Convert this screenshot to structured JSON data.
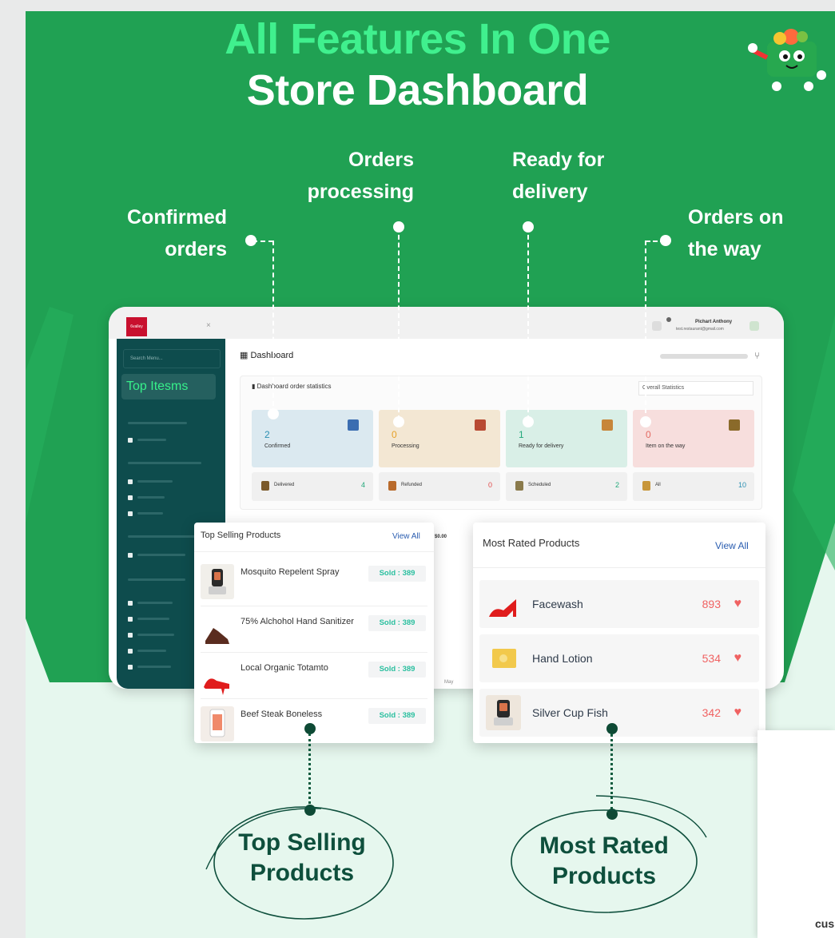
{
  "headline": {
    "line1": "All Features In One",
    "line2": "Store Dashboard"
  },
  "callouts": {
    "confirmed": {
      "line1": "Confirmed",
      "line2": "orders"
    },
    "processing": {
      "line1": "Orders",
      "line2": "processing"
    },
    "ready": {
      "line1": "Ready for",
      "line2": "delivery"
    },
    "on_the_way": {
      "line1": "Orders on",
      "line2": "the way"
    }
  },
  "dashboard": {
    "logo_text": "6valley",
    "close_icon": "×",
    "user_name": "Pichart Anthony",
    "user_email": "test.restaurant@gmail.com",
    "sidebar": {
      "search_placeholder": "Search Menu...",
      "active_item": "Top Itesms"
    },
    "page_title": "Dashboard",
    "stats_title": "Dashboard order statistics",
    "stats_select": "Overall Statistics",
    "cards": [
      {
        "value": "2",
        "label": "Confirmed",
        "bg": "#dbe9f0",
        "num_color": "#2b8fb2",
        "icon": "clipboard-icon"
      },
      {
        "value": "0",
        "label": "Processing",
        "bg": "#f3e7d3",
        "num_color": "#e6a128",
        "icon": "box-icon"
      },
      {
        "value": "1",
        "label": "Ready for delivery",
        "bg": "#d9efe7",
        "num_color": "#22a87a",
        "icon": "delivery-icon"
      },
      {
        "value": "0",
        "label": "Item on the way",
        "bg": "#f7dedd",
        "num_color": "#e36a62",
        "icon": "map-icon"
      }
    ],
    "mini_stats": [
      {
        "label": "Delivered",
        "value": "4",
        "color": "#22a87a"
      },
      {
        "label": "Refunded",
        "value": "0",
        "color": "#e24b4b"
      },
      {
        "label": "Scheduled",
        "value": "2",
        "color": "#22a87a"
      },
      {
        "label": "All",
        "value": "10",
        "color": "#2b8fb2"
      }
    ],
    "chart_fragment": "$0.00",
    "chart_axis_fragment": "May"
  },
  "top_selling": {
    "title": "Top Selling Products",
    "view_all": "View All",
    "items": [
      {
        "name": "Mosquito Repelent Spray",
        "sold": "Sold : 389"
      },
      {
        "name": "75% Alchohol Hand Sanitizer",
        "sold": "Sold : 389"
      },
      {
        "name": "Local Organic Totamto",
        "sold": "Sold : 389"
      },
      {
        "name": "Beef Steak Boneless",
        "sold": "Sold : 389"
      }
    ]
  },
  "most_rated": {
    "title": "Most Rated Products",
    "view_all": "View All",
    "items": [
      {
        "name": "Facewash",
        "count": "893"
      },
      {
        "name": "Hand Lotion",
        "count": "534"
      },
      {
        "name": "Silver Cup Fish",
        "count": "342"
      }
    ]
  },
  "bottom_labels": {
    "top_selling": {
      "line1": "Top Selling",
      "line2": "Products"
    },
    "most_rated": {
      "line1": "Most Rated",
      "line2": "Products"
    }
  },
  "corner_fragment": "cus",
  "colors": {
    "brand_green": "#20a153",
    "accent_green": "#40f08e",
    "sidebar_teal": "#0e4c4d",
    "heart_red": "#f06262"
  }
}
